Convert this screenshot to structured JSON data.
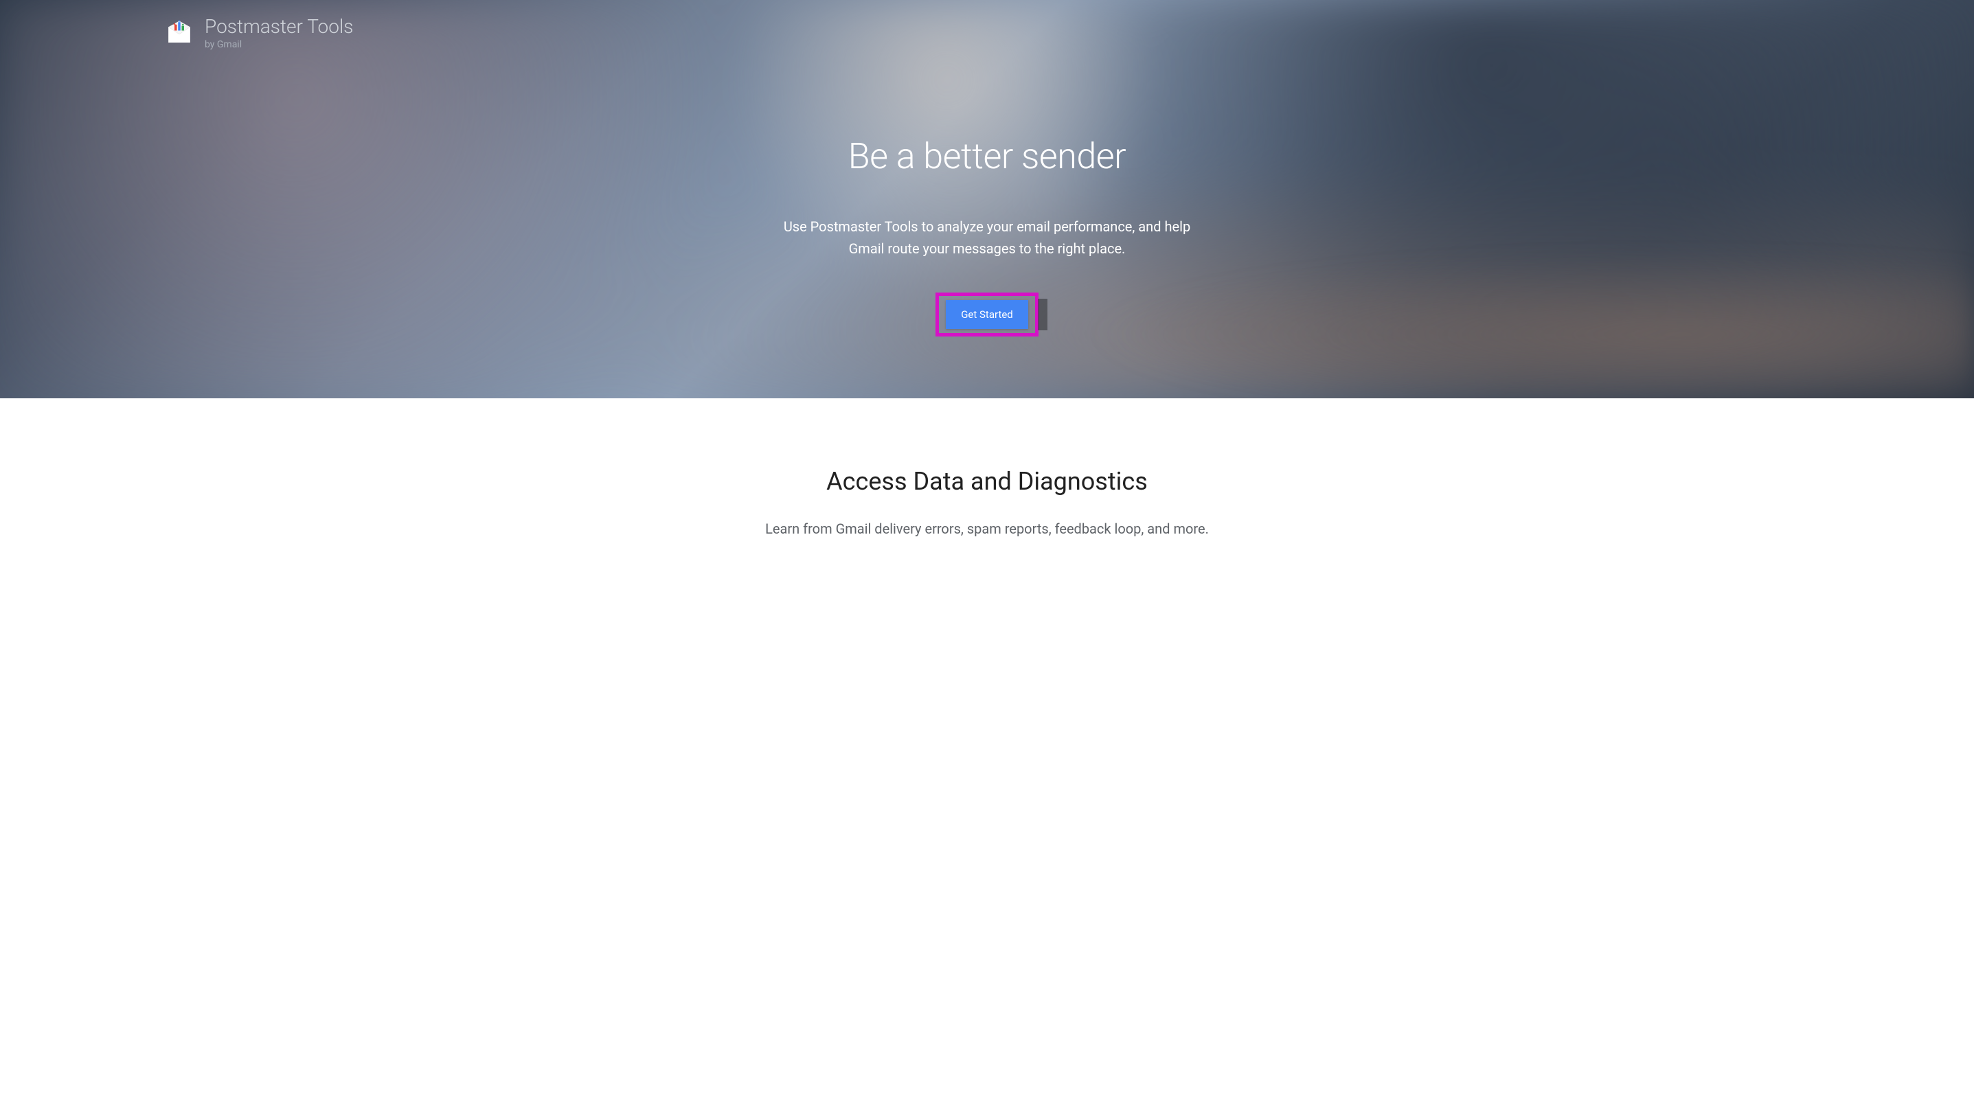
{
  "header": {
    "product_name": "Postmaster Tools",
    "tagline": "by Gmail"
  },
  "hero": {
    "title": "Be a better sender",
    "subtitle": "Use Postmaster Tools to analyze your email performance, and help Gmail route your messages to the right place.",
    "cta_label": "Get Started"
  },
  "section1": {
    "title": "Access Data and Diagnostics",
    "subtitle": "Learn from Gmail delivery errors, spam reports, feedback loop, and more."
  },
  "colors": {
    "cta_button": "#4285f4",
    "highlight_border": "#d611c7"
  },
  "annotation": {
    "highlighted_element": "get-started-button"
  }
}
